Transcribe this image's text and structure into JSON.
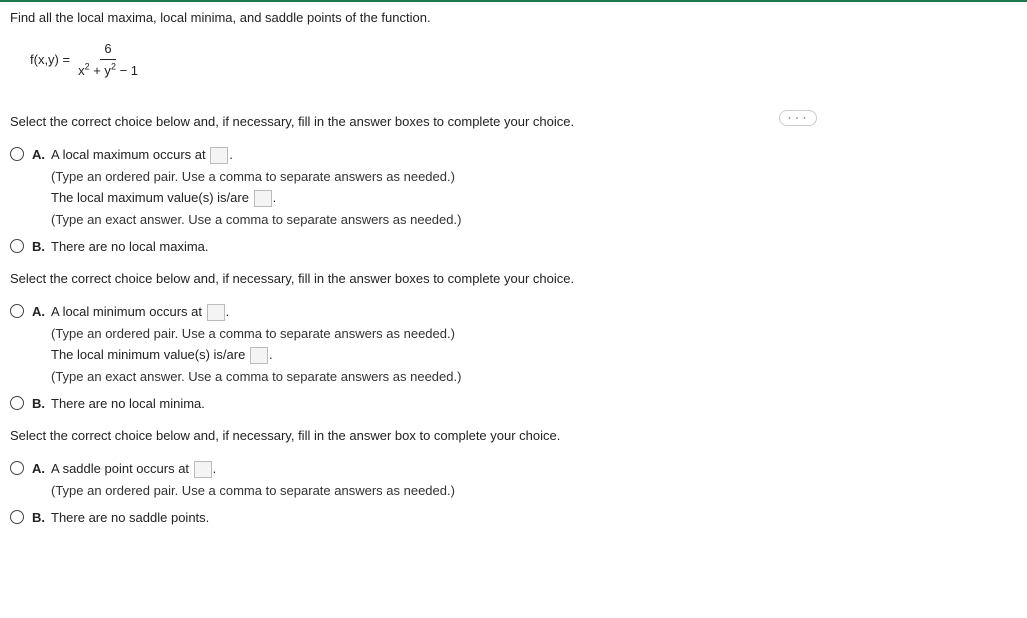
{
  "question": {
    "prompt": "Find all the local maxima, local minima, and saddle points of the function.",
    "formula": {
      "lhs": "f(x,y) =",
      "numerator": "6",
      "denominator_pre": "x",
      "denominator_mid": " + y",
      "denominator_post": " − 1",
      "exponent": "2"
    }
  },
  "sections": [
    {
      "prompt": "Select the correct choice below and, if necessary, fill in the answer boxes to complete your choice.",
      "options": [
        {
          "label": "A.",
          "line1_pre": "A local maximum occurs at ",
          "line1_post": ".",
          "hint1": "(Type an ordered pair. Use a comma to separate answers as needed.)",
          "line2_pre": "The local maximum value(s) is/are ",
          "line2_post": ".",
          "hint2": "(Type an exact answer. Use a comma to separate answers as needed.)"
        },
        {
          "label": "B.",
          "line1": "There are no local maxima."
        }
      ]
    },
    {
      "prompt": "Select the correct choice below and, if necessary, fill in the answer boxes to complete your choice.",
      "options": [
        {
          "label": "A.",
          "line1_pre": "A local minimum occurs at ",
          "line1_post": ".",
          "hint1": "(Type an ordered pair. Use a comma to separate answers as needed.)",
          "line2_pre": "The local minimum value(s) is/are ",
          "line2_post": ".",
          "hint2": "(Type an exact answer. Use a comma to separate answers as needed.)"
        },
        {
          "label": "B.",
          "line1": "There are no local minima."
        }
      ]
    },
    {
      "prompt": "Select the correct choice below and, if necessary, fill in the answer box to complete your choice.",
      "options": [
        {
          "label": "A.",
          "line1_pre": "A saddle point occurs at ",
          "line1_post": ".",
          "hint1": "(Type an ordered pair. Use a comma to separate answers as needed.)"
        },
        {
          "label": "B.",
          "line1": "There are no saddle points."
        }
      ]
    }
  ]
}
